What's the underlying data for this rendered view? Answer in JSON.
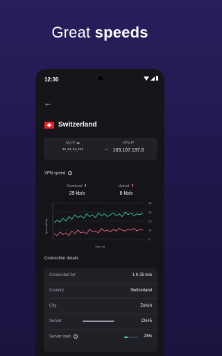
{
  "headline": {
    "regular": "Great ",
    "bold": "speeds"
  },
  "status_bar": {
    "time": "12:30"
  },
  "location": {
    "country": "Switzerland"
  },
  "ip": {
    "my_label": "My IP",
    "my_value": "**.**.**.***",
    "vpn_label": "VPN IP",
    "vpn_value": "103.107.197.6"
  },
  "speed": {
    "title": "VPN speed",
    "download_label": "Download",
    "download_value": "29 kb/s",
    "upload_label": "Upload",
    "upload_value": "8 kb/s"
  },
  "chart_data": {
    "type": "line",
    "xlabel": "Time (s)",
    "ylabel": "Speed (kb/s)",
    "ylim": [
      0,
      40
    ],
    "y_ticks": [
      "40",
      "30",
      "20",
      "10",
      "0"
    ],
    "series": [
      {
        "name": "Download",
        "values": [
          18,
          21,
          19,
          23,
          20,
          25,
          22,
          27,
          24,
          26,
          23,
          28,
          25,
          27,
          24,
          29,
          26,
          28,
          25,
          27,
          29,
          26,
          28,
          25,
          30,
          27,
          29,
          26,
          28,
          27,
          29
        ]
      },
      {
        "name": "Upload",
        "values": [
          6,
          4,
          8,
          5,
          7,
          4,
          9,
          6,
          10,
          7,
          8,
          6,
          11,
          8,
          9,
          7,
          12,
          9,
          10,
          8,
          11,
          9,
          12,
          10,
          9,
          11,
          10,
          12,
          9,
          11,
          10
        ]
      }
    ],
    "colors": {
      "download": "#3fcf8e",
      "upload": "#f06a76"
    }
  },
  "connection": {
    "title": "Connection details",
    "rows": [
      {
        "label": "Connected for",
        "value": "1 h 25 min"
      },
      {
        "label": "Country",
        "value": "Switzerland"
      },
      {
        "label": "City",
        "value": "Zurich"
      },
      {
        "label": "Server",
        "value": "CH#5"
      },
      {
        "label": "Server load",
        "value": "23%",
        "load": 0.23
      }
    ]
  }
}
